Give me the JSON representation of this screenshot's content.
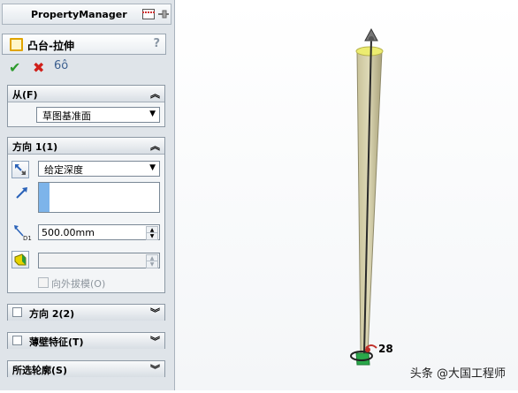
{
  "property_manager": {
    "title": "PropertyManager",
    "feature_name": "凸台-拉伸",
    "help": "?"
  },
  "actions": {
    "ok": "✔",
    "cancel": "✖",
    "preview": "6ô"
  },
  "from_section": {
    "title": "从(F)",
    "start_condition": "草图基准面"
  },
  "direction1": {
    "title": "方向 1(1)",
    "end_condition": "给定深度",
    "depth": "500.00mm",
    "draft_outward_label": "向外拔模(O)"
  },
  "direction2": {
    "title": "方向 2(2)"
  },
  "thin_feature": {
    "title": "薄壁特征(T)"
  },
  "selected_contours": {
    "title": "所选轮廓(S)"
  },
  "viewport": {
    "dimension_label": "28",
    "watermark": "头条 @大国工程师"
  }
}
